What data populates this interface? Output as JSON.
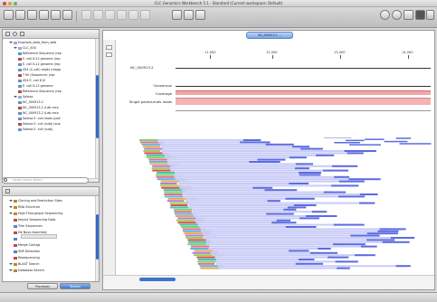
{
  "window": {
    "title": "CLC Genomics Workbench 5.1 - Standard (Current workspace: Default)"
  },
  "toolbar": {
    "items": [
      "Show",
      "Save",
      "Import",
      "Export",
      "Graphics",
      "Print",
      "Workbench",
      "Plug-ins",
      "Support",
      "Favorites",
      "Search"
    ]
  },
  "navigation": {
    "rows": [
      {
        "label": "Example_data_from_web",
        "depth": 1,
        "folder": true
      },
      {
        "label": "CLC_454",
        "depth": 2,
        "folder": true
      },
      {
        "label": "Reference Sequence (rep",
        "depth": 3
      },
      {
        "label": "E. coli K-12 genome (rep",
        "depth": 3
      },
      {
        "label": "E. coli K-12 genome (rep",
        "depth": 3
      },
      {
        "label": "454 (C-coli) reads (mapp",
        "depth": 3
      },
      {
        "label": "T fill (Sequence) (rep",
        "depth": 3
      },
      {
        "label": "454 E. coli K12",
        "depth": 3
      },
      {
        "label": "E. coli K-12 genome",
        "depth": 3
      },
      {
        "label": "Reference Sequence (rep",
        "depth": 3
      },
      {
        "label": "Solexa",
        "depth": 2,
        "folder": true
      },
      {
        "label": "NC_000913.2",
        "depth": 3
      },
      {
        "label": "NC_000913.2 (Lab reco",
        "depth": 3
      },
      {
        "label": "NC_000913.2 (Lab reco",
        "depth": 3
      },
      {
        "label": "Solexa E. coli reads (pair",
        "depth": 3
      },
      {
        "label": "Solexa E. coli (subj) (sub",
        "depth": 3
      },
      {
        "label": "Solexa E. coli (subj)",
        "depth": 3
      }
    ],
    "search_placeholder": "<enter search term>"
  },
  "toolbox": {
    "rows": [
      {
        "label": "Cloning and Restriction Sites",
        "depth": 1
      },
      {
        "label": "RNA Structure",
        "depth": 1
      },
      {
        "label": "High-Throughput Sequencing",
        "depth": 1,
        "open": true
      },
      {
        "label": "Import Sequencing Data",
        "depth": 2
      },
      {
        "label": "Trim Sequences",
        "depth": 2
      },
      {
        "label": "De Novo Assembly",
        "depth": 2
      },
      {
        "label": "",
        "depth": 2
      },
      {
        "label": "Merge Contigs",
        "depth": 2
      },
      {
        "label": "SNP Detection",
        "depth": 2
      },
      {
        "label": "Resequencing",
        "depth": 2
      },
      {
        "label": "BLAST Search",
        "depth": 1
      },
      {
        "label": "Database Search",
        "depth": 1
      }
    ],
    "tabs": [
      "Processes",
      "Toolbox"
    ],
    "active_tab": "Toolbox"
  },
  "editor": {
    "tab_label": "NC_000913.2 ...",
    "ruler": [
      "11,000",
      "12,000",
      "13,000",
      "14,000"
    ],
    "tracks": {
      "reference": "NC_000913.2",
      "consensus": "Consensus",
      "coverage": "Coverage",
      "paired": "Single paired-ends reads"
    }
  },
  "colors": {
    "read_blue": "#5b6be0",
    "read_light": "#c9ccf7",
    "coverage_fill": "#f2a7a7",
    "selection_blue": "#3b74cc"
  }
}
